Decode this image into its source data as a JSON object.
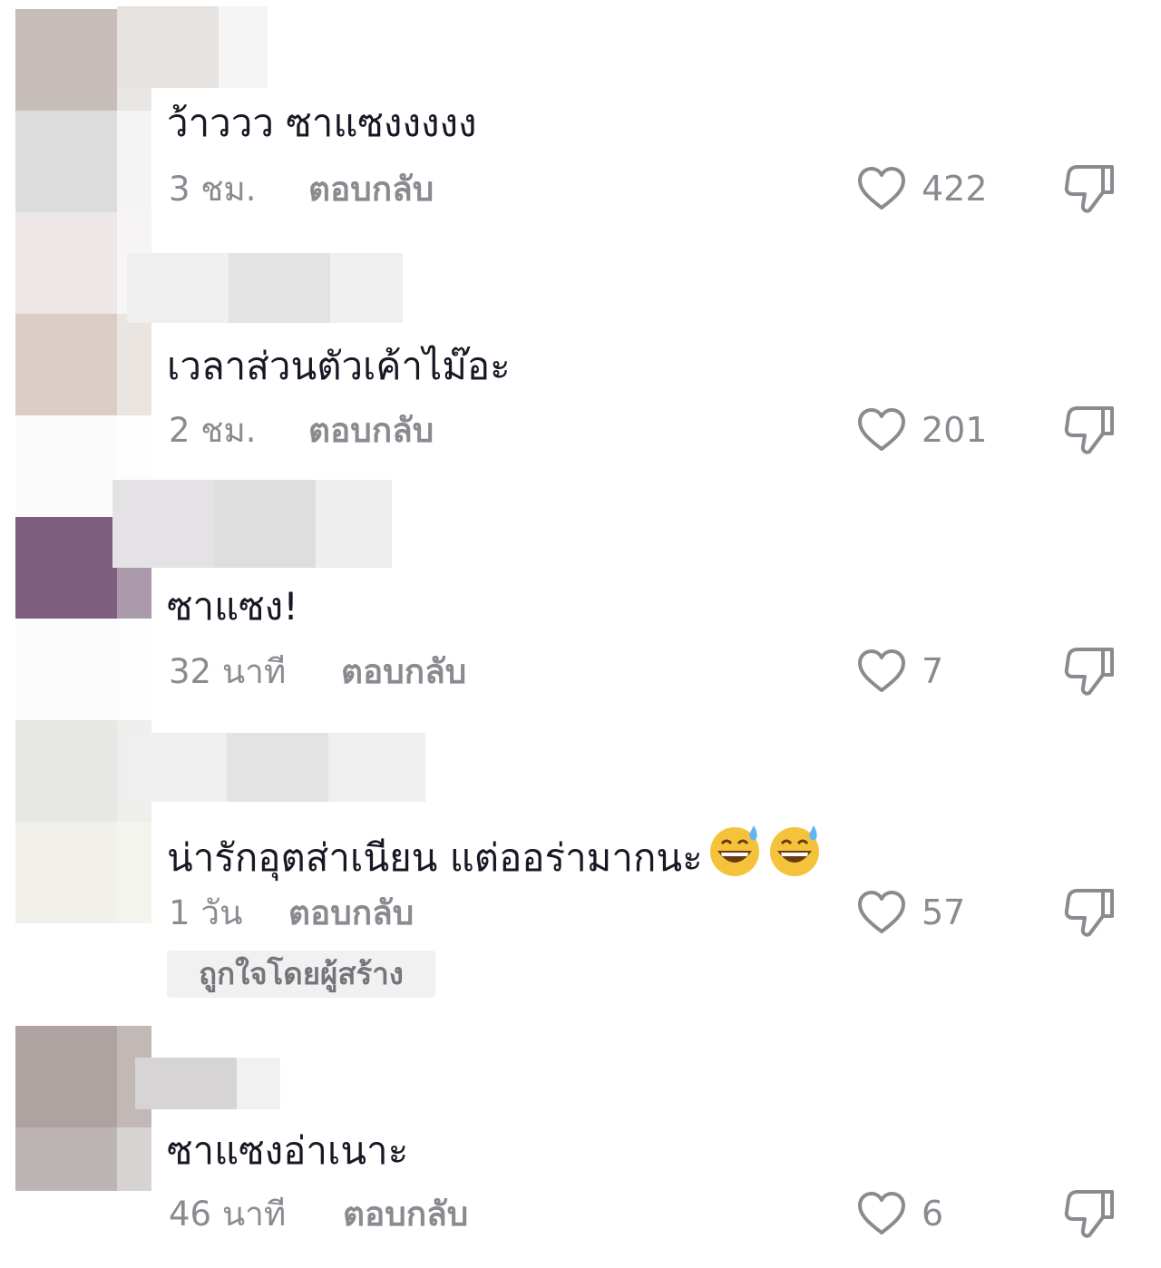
{
  "comments": [
    {
      "text": "ว้าววว ซาแซงงงงง",
      "time": "3 ชม.",
      "reply": "ตอบกลับ",
      "likes": "422"
    },
    {
      "text": "เวลาส่วนตัวเค้าไม๊อะ",
      "time": "2 ชม.",
      "reply": "ตอบกลับ",
      "likes": "201"
    },
    {
      "text": "ซาแซง!",
      "time": "32 นาที",
      "reply": "ตอบกลับ",
      "likes": "7"
    },
    {
      "text": "น่ารักอุตส่าเนียน แต่ออร่ามากนะ",
      "time": "1 วัน",
      "reply": "ตอบกลับ",
      "likes": "57",
      "badge": "ถูกใจโดยผู้สร้าง",
      "emoji": "sweat-smile-emoji"
    },
    {
      "text": "ซาแซงอ่าเนาะ",
      "time": "46 นาที",
      "reply": "ตอบกลับ",
      "likes": "6"
    }
  ],
  "icons": {
    "like": "heart-outline-icon",
    "dislike": "thumbs-down-icon"
  },
  "colors": {
    "text": "#161823",
    "meta": "#8a8b91",
    "badge_bg": "#f1f1f2"
  }
}
